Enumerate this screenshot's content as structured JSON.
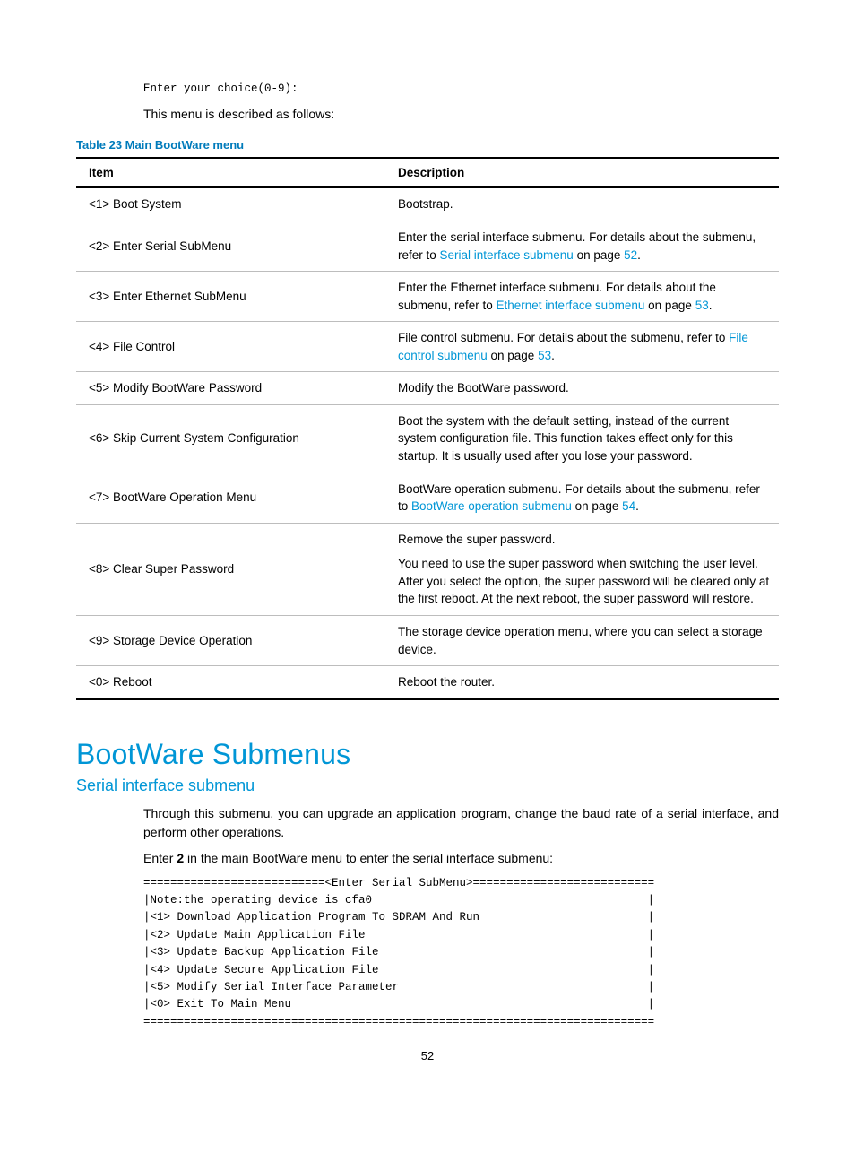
{
  "prompt": "Enter your choice(0-9):",
  "intro": "This menu is described as follows:",
  "tableCaption": "Table 23 Main BootWare menu",
  "thead": {
    "item": "Item",
    "desc": "Description"
  },
  "rows": {
    "r1": {
      "item": "<1> Boot System",
      "desc": "Bootstrap."
    },
    "r2": {
      "item": "<2> Enter Serial SubMenu",
      "d1": "Enter the serial interface submenu. For details about the submenu, refer to ",
      "link": "Serial interface submenu",
      "d2": " on page ",
      "page": "52",
      "d3": "."
    },
    "r3": {
      "item": "<3> Enter Ethernet SubMenu",
      "d1": "Enter the Ethernet interface submenu. For details about the submenu, refer to ",
      "link": "Ethernet interface submenu",
      "d2": " on page ",
      "page": "53",
      "d3": "."
    },
    "r4": {
      "item": "<4> File Control",
      "d1": "File control submenu. For details about the submenu, refer to ",
      "link": "File control submenu",
      "d2": " on page ",
      "page": "53",
      "d3": "."
    },
    "r5": {
      "item": "<5> Modify BootWare Password",
      "desc": "Modify the BootWare password."
    },
    "r6": {
      "item": "<6> Skip Current System Configuration",
      "desc": "Boot the system with the default setting, instead of the current system configuration file. This function takes effect only for this startup. It is usually used after you lose your password."
    },
    "r7": {
      "item": "<7> BootWare Operation Menu",
      "d1": "BootWare operation submenu. For details about the submenu, refer to ",
      "link": "BootWare operation submenu",
      "d2": " on page ",
      "page": "54",
      "d3": "."
    },
    "r8": {
      "item": "<8> Clear Super Password",
      "p1": "Remove the super password.",
      "p2": "You need to use the super password when switching the user level. After you select the option, the super password will be cleared only at the first reboot. At the next reboot, the super password will restore."
    },
    "r9": {
      "item": "<9> Storage Device Operation",
      "desc": "The storage device operation menu, where you can select a storage device."
    },
    "r0": {
      "item": "<0> Reboot",
      "desc": "Reboot the router."
    }
  },
  "h1": "BootWare Submenus",
  "h2": "Serial interface submenu",
  "p1": "Through this submenu, you can upgrade an application program, change the baud rate of a serial interface, and perform other operations.",
  "p2a": "Enter ",
  "p2b": "2",
  "p2c": " in the main BootWare menu to enter the serial interface submenu:",
  "code": {
    "l1": "===========================<Enter Serial SubMenu>===========================",
    "l2": "|Note:the operating device is cfa0                                         |",
    "l3": "|<1> Download Application Program To SDRAM And Run                         |",
    "l4": "|<2> Update Main Application File                                          |",
    "l5": "|<3> Update Backup Application File                                        |",
    "l6": "|<4> Update Secure Application File                                        |",
    "l7": "|<5> Modify Serial Interface Parameter                                     |",
    "l8": "|<0> Exit To Main Menu                                                     |",
    "l9": "============================================================================"
  },
  "pageNumber": "52"
}
